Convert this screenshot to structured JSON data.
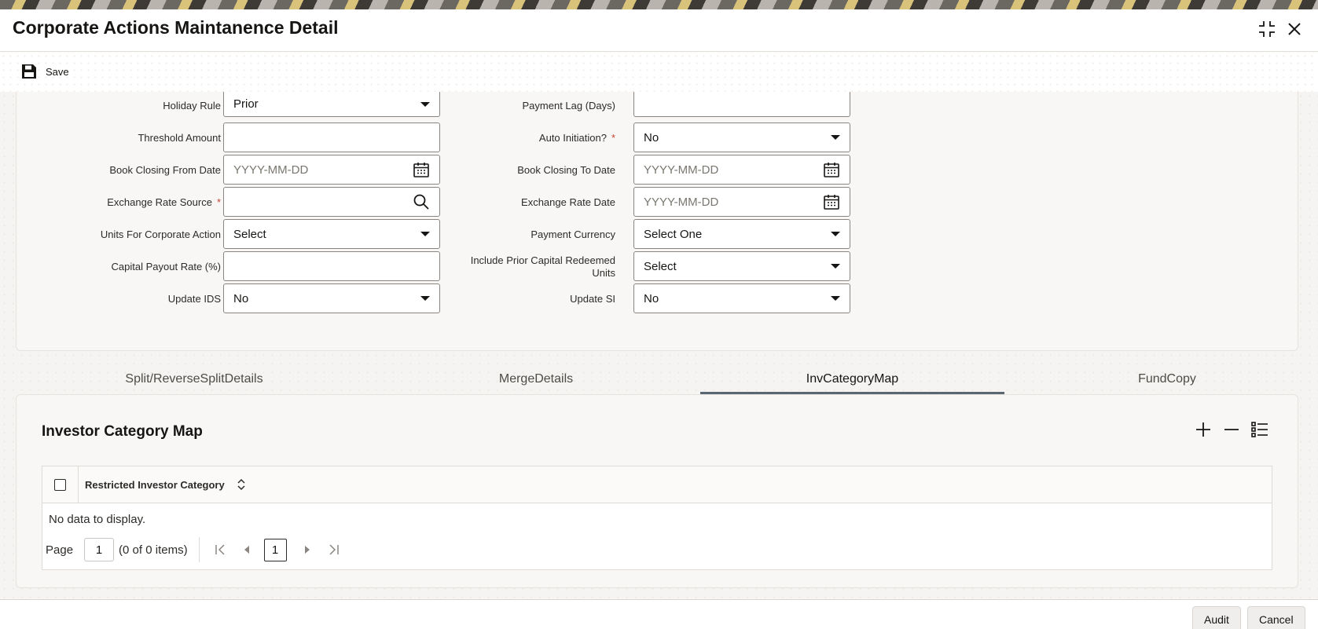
{
  "window": {
    "title": "Corporate Actions Maintanence Detail"
  },
  "toolbar": {
    "save_label": "Save",
    "save_icon": "save-icon"
  },
  "form": {
    "left": [
      {
        "label": "Holiday Rule",
        "value": "Prior",
        "type": "select",
        "required": false
      },
      {
        "label": "Threshold Amount",
        "value": "",
        "type": "text",
        "required": false
      },
      {
        "label": "Book Closing From Date",
        "placeholder": "YYYY-MM-DD",
        "type": "date",
        "required": false
      },
      {
        "label": "Exchange Rate Source",
        "value": "",
        "type": "lookup",
        "required": true
      },
      {
        "label": "Units For Corporate Action",
        "value": "Select",
        "type": "select",
        "required": false
      },
      {
        "label": "Capital Payout Rate (%)",
        "value": "",
        "type": "text",
        "required": false
      },
      {
        "label": "Update IDS",
        "value": "No",
        "type": "select",
        "required": false
      }
    ],
    "right": [
      {
        "label": "Payment Lag (Days)",
        "value": "",
        "type": "text",
        "required": false
      },
      {
        "label": "Auto Initiation?",
        "value": "No",
        "type": "select",
        "required": true
      },
      {
        "label": "Book Closing To Date",
        "placeholder": "YYYY-MM-DD",
        "type": "date",
        "required": false
      },
      {
        "label": "Exchange Rate Date",
        "placeholder": "YYYY-MM-DD",
        "type": "date",
        "required": false
      },
      {
        "label": "Payment Currency",
        "value": "Select One",
        "type": "select",
        "required": false
      },
      {
        "label": "Include Prior Capital Redeemed Units",
        "value": "Select",
        "type": "select",
        "required": false
      },
      {
        "label": "Update SI",
        "value": "No",
        "type": "select",
        "required": false
      }
    ],
    "required_marker": "*"
  },
  "tabs": [
    {
      "label": "Split/ReverseSplitDetails",
      "active": false
    },
    {
      "label": "MergeDetails",
      "active": false
    },
    {
      "label": "InvCategoryMap",
      "active": true
    },
    {
      "label": "FundCopy",
      "active": false
    }
  ],
  "grid": {
    "title": "Investor Category Map",
    "column": "Restricted Investor Category",
    "empty_text": "No data to display.",
    "pager": {
      "page_label": "Page",
      "page_value": "1",
      "items_info": "(0 of 0 items)",
      "current_page": "1"
    }
  },
  "footer": {
    "audit_label": "Audit",
    "cancel_label": "Cancel"
  },
  "colors": {
    "required": "#c74634",
    "active_tab_underline": "#5a6671"
  }
}
